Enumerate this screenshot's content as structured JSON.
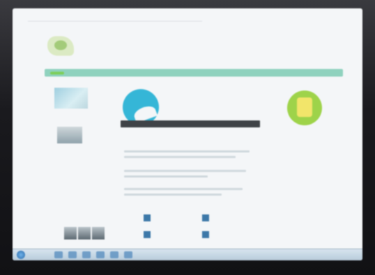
{
  "browser": {
    "address_text": ""
  },
  "site": {
    "logo_text": "",
    "tagline": "",
    "nav": [
      "",
      "",
      "",
      ""
    ],
    "headline_line1": "",
    "headline_line2": "",
    "url_overlay": "",
    "badge_caption": ""
  },
  "sidebar": {
    "caption1": "",
    "caption2": "",
    "link": ""
  },
  "taskbar": {
    "clock": ""
  },
  "colors": {
    "nav": "#8fd2be",
    "nav_active": "#7ecf5a",
    "accent_blue": "#35b6d7",
    "badge_green": "#9ed34a"
  }
}
